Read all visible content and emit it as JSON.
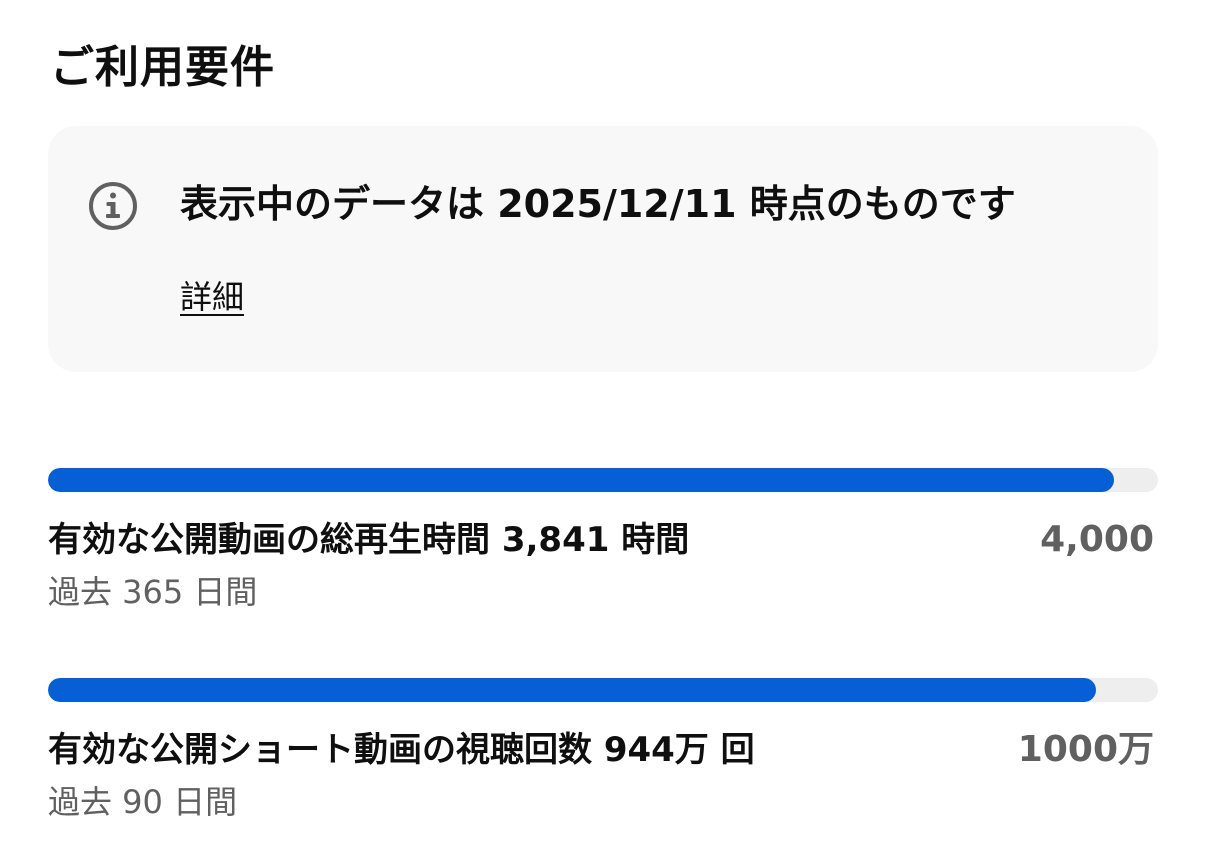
{
  "section": {
    "title": "ご利用要件"
  },
  "info": {
    "icon": "info-icon",
    "message": "表示中のデータは 2025/12/11 時点のものです",
    "details_link": "詳細"
  },
  "requirements": [
    {
      "label": "有効な公開動画の総再生時間 3,841 時間",
      "target": "4,000",
      "period": "過去 365 日間",
      "progress": 0.96,
      "color": "#065fd4"
    },
    {
      "label": "有効な公開ショート動画の視聴回数 944万 回",
      "target": "1000万",
      "period": "過去 90 日間",
      "progress": 0.944,
      "color": "#065fd4"
    }
  ]
}
